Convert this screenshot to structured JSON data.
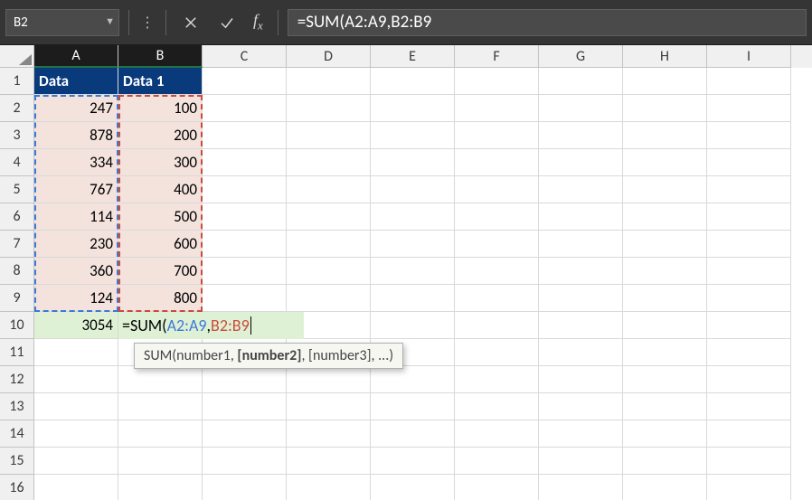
{
  "name_box": "B2",
  "formula_bar": "=SUM(A2:A9,B2:B9",
  "columns": [
    "A",
    "B",
    "C",
    "D",
    "E",
    "F",
    "G",
    "H",
    "I"
  ],
  "active_columns": [
    "A",
    "B"
  ],
  "rows_visible": 16,
  "headers": {
    "A1": "Data",
    "B1": "Data 1"
  },
  "data_A": [
    247,
    878,
    334,
    767,
    114,
    230,
    360,
    124
  ],
  "data_B": [
    100,
    200,
    300,
    400,
    500,
    600,
    700,
    800
  ],
  "A10": 3054,
  "B10_formula": {
    "prefix": "=SUM(",
    "range1": "A2:A9",
    "comma": ",",
    "range2": "B2:B9"
  },
  "tooltip": {
    "fn": "SUM",
    "open": "(",
    "arg1": "number1",
    "sep1": ", ",
    "arg2": "[number2]",
    "sep2": ", ",
    "arg3": "[number3]",
    "rest": ", ...)"
  },
  "chart_data": {
    "type": "table",
    "columns": [
      "Data",
      "Data 1"
    ],
    "rows": [
      [
        247,
        100
      ],
      [
        878,
        200
      ],
      [
        334,
        300
      ],
      [
        767,
        400
      ],
      [
        114,
        500
      ],
      [
        230,
        600
      ],
      [
        360,
        700
      ],
      [
        124,
        800
      ]
    ],
    "A10_sum": 3054,
    "B10_formula": "=SUM(A2:A9,B2:B9"
  }
}
